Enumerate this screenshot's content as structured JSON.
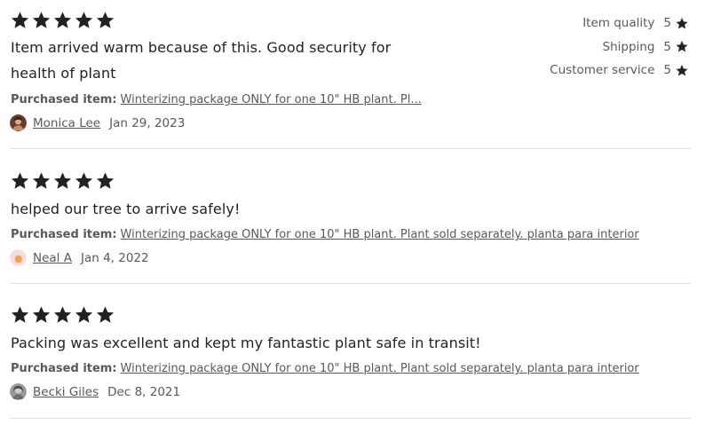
{
  "reviews": [
    {
      "stars": 5,
      "text_line1": "Item arrived warm because of this. Good security for",
      "text_line2": "health of plant",
      "purchased_label": "Purchased item:",
      "purchased_item": "Winterizing package ONLY for one 10\" HB plant. Pl...",
      "reviewer": "Monica Lee",
      "date": "Jan 29, 2023",
      "ratings": [
        {
          "label": "Item quality",
          "value": "5"
        },
        {
          "label": "Shipping",
          "value": "5"
        },
        {
          "label": "Customer service",
          "value": "5"
        }
      ]
    },
    {
      "stars": 5,
      "text": "helped our tree to arrive safely!",
      "purchased_label": "Purchased item:",
      "purchased_item": "Winterizing package ONLY for one 10\" HB plant. Plant sold separately. planta para interior",
      "reviewer": "Neal A",
      "date": "Jan 4, 2022"
    },
    {
      "stars": 5,
      "text": "Packing was excellent and kept my fantastic plant safe in transit!",
      "purchased_label": "Purchased item:",
      "purchased_item": "Winterizing package ONLY for one 10\" HB plant. Plant sold separately. planta para interior",
      "reviewer": "Becki Giles",
      "date": "Dec 8, 2021"
    }
  ],
  "colors": {
    "star": "#222222",
    "text": "#222222",
    "muted": "#595959",
    "divider": "#e1e1e1"
  },
  "icons": {
    "star": "star-icon",
    "avatar": "avatar-icon"
  }
}
